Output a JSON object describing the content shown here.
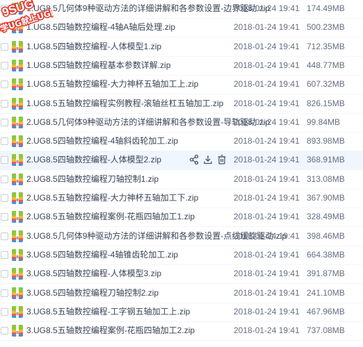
{
  "watermark": {
    "line1": "9SUG",
    "line2": "学UG就上UG网",
    "color": "#e03a2f"
  },
  "colors": {
    "icon_green": "#8dc63f",
    "icon_yellow": "#f7b731",
    "icon_red": "#ee5a52",
    "icon_blue": "#3f8fe8",
    "hover_row": "#f0f6fd",
    "action_icon": "#4a5468"
  },
  "hover_actions": [
    "share-icon",
    "download-icon",
    "delete-icon"
  ],
  "files": [
    {
      "name": "1.UG8.5几何体9种驱动方法的详细讲解和各参数设置-边界驱动.zip",
      "date": "2018-01-24 19:41",
      "size": "174.49MB"
    },
    {
      "name": "1.UG8.5四轴数控编程-4轴A轴后处理.zip",
      "date": "2018-01-24 19:41",
      "size": "500.23MB"
    },
    {
      "name": "1.UG8.5四轴数控编程-人体模型1.zip",
      "date": "2018-01-24 19:41",
      "size": "712.35MB"
    },
    {
      "name": "1.UG8.5四轴数控编程基本参数详解.zip",
      "date": "2018-01-24 19:41",
      "size": "448.77MB"
    },
    {
      "name": "1.UG8.5五轴数控编程-大力神杯五轴加工上.zip",
      "date": "2018-01-24 19:41",
      "size": "607.32MB"
    },
    {
      "name": "1.UG8.5五轴数控编程实例教程-滚轴丝杠五轴加工.zip",
      "date": "2018-01-24 19:41",
      "size": "826.15MB"
    },
    {
      "name": "2.UG8.5几何体9种驱动方法的详细讲解和各参数设置-导轨驱动.zip",
      "date": "2018-01-24 19:41",
      "size": "99.84MB"
    },
    {
      "name": "2.UG8.5四轴数控编程-4轴斜齿轮加工.zip",
      "date": "2018-01-24 19:41",
      "size": "893.98MB"
    },
    {
      "name": "2.UG8.5四轴数控编程-人体模型2.zip",
      "date": "2018-01-24 19:41",
      "size": "368.91MB",
      "hover": true
    },
    {
      "name": "2.UG8.5四轴数控编程刀轴控制1.zip",
      "date": "2018-01-24 19:41",
      "size": "313.08MB"
    },
    {
      "name": "2.UG8.5五轴数控编程-大力神杯五轴加工下.zip",
      "date": "2018-01-24 19:41",
      "size": "367.90MB"
    },
    {
      "name": "2.UG8.5五轴数控编程案例-花瓶四轴加工1.zip",
      "date": "2018-01-24 19:41",
      "size": "328.49MB"
    },
    {
      "name": "3.UG8.5几何体9种驱动方法的详细讲解和各参数设置-点线缓旋驱动.zip",
      "date": "2018-01-24 19:41",
      "size": "398.46MB"
    },
    {
      "name": "3.UG8.5四轴数控编程-4轴锥齿轮加工.zip",
      "date": "2018-01-24 19:41",
      "size": "664.38MB"
    },
    {
      "name": "3.UG8.5四轴数控编程-人体模型3.zip",
      "date": "2018-01-24 19:41",
      "size": "391.87MB"
    },
    {
      "name": "3.UG8.5四轴数控编程刀轴控制2.zip",
      "date": "2018-01-24 19:41",
      "size": "241.10MB"
    },
    {
      "name": "3.UG8.5五轴数控编程-工字钢五轴加工上.zip",
      "date": "2018-01-24 19:41",
      "size": "467.96MB"
    },
    {
      "name": "3.UG8.5五轴数控编程案例-花瓶四轴加工2.zip",
      "date": "2018-01-24 19:41",
      "size": "737.08MB"
    }
  ]
}
